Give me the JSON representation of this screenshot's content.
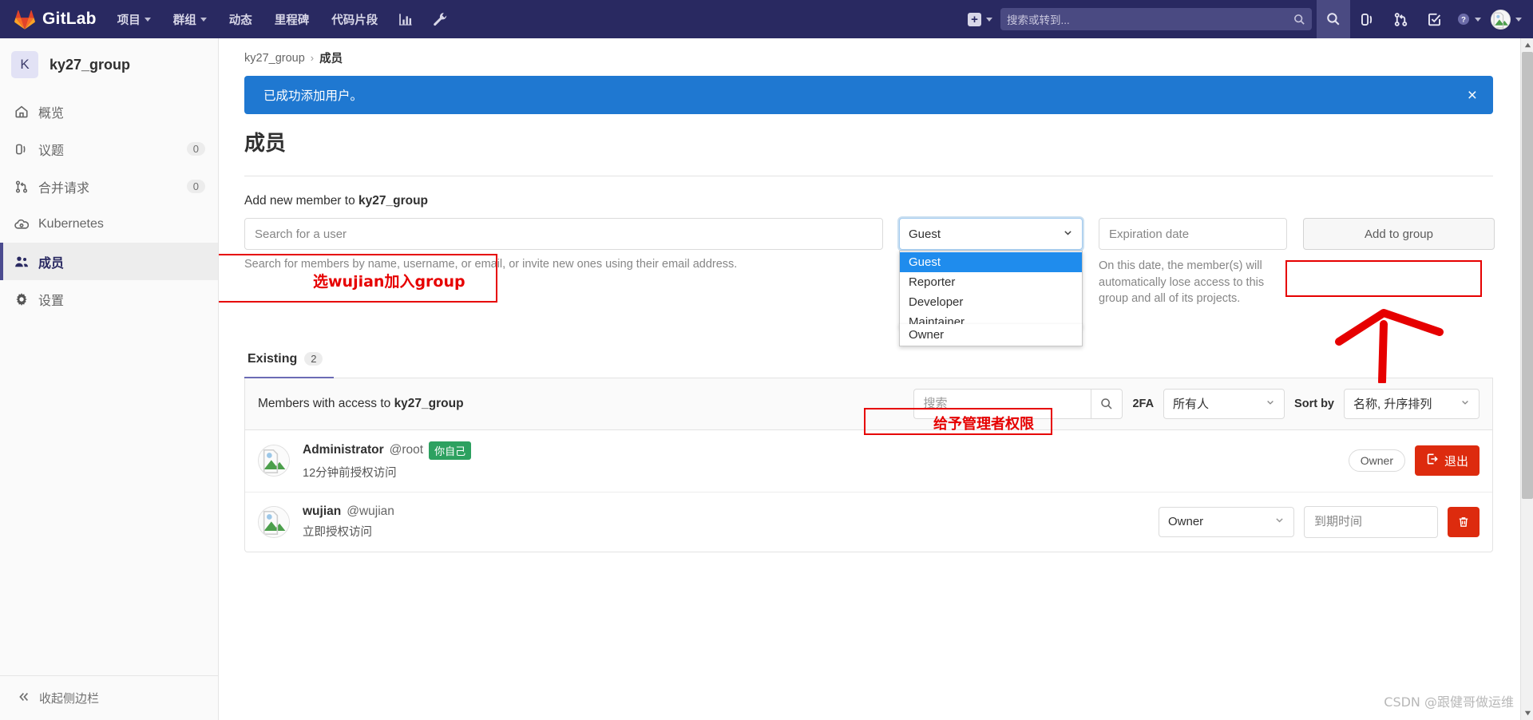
{
  "topnav": {
    "brand": "GitLab",
    "links": [
      {
        "label": "项目",
        "has_caret": true
      },
      {
        "label": "群组",
        "has_caret": true
      },
      {
        "label": "动态",
        "has_caret": false
      },
      {
        "label": "里程碑",
        "has_caret": false
      },
      {
        "label": "代码片段",
        "has_caret": false
      }
    ],
    "icon_links": [
      {
        "name": "analytics-icon"
      },
      {
        "name": "wrench-icon"
      }
    ],
    "create_label": "+",
    "search_placeholder": "搜索或转到...",
    "right_icons": [
      {
        "name": "search-icon"
      },
      {
        "name": "issues-icon"
      },
      {
        "name": "merge-requests-icon"
      },
      {
        "name": "todos-icon"
      },
      {
        "name": "help-icon"
      }
    ]
  },
  "sidebar": {
    "group_initial": "K",
    "group_name": "ky27_group",
    "items": [
      {
        "label": "概览",
        "icon": "home-icon",
        "count": null,
        "active": false
      },
      {
        "label": "议题",
        "icon": "issues-icon",
        "count": "0",
        "active": false
      },
      {
        "label": "合并请求",
        "icon": "merge-request-icon",
        "count": "0",
        "active": false
      },
      {
        "label": "Kubernetes",
        "icon": "kubernetes-icon",
        "count": null,
        "active": false
      },
      {
        "label": "成员",
        "icon": "users-icon",
        "count": null,
        "active": true
      },
      {
        "label": "设置",
        "icon": "gear-icon",
        "count": null,
        "active": false
      }
    ],
    "collapse_label": "收起侧边栏"
  },
  "breadcrumb": {
    "root": "ky27_group",
    "separator": "›",
    "current": "成员"
  },
  "alert": {
    "message": "已成功添加用户。",
    "close": "×"
  },
  "page": {
    "title": "成员"
  },
  "add_member": {
    "label_prefix": "Add new member to ",
    "group_name": "ky27_group",
    "search_placeholder": "Search for a user",
    "help_text": "Search for members by name, username, or email, or invite new ones using their email address.",
    "role_selected": "Guest",
    "role_options": [
      "Guest",
      "Reporter",
      "Developer",
      "Maintainer",
      "Owner"
    ],
    "expiration_placeholder": "Expiration date",
    "expiration_note": "On this date, the member(s) will automatically lose access to this group and all of its projects.",
    "add_button": "Add to group"
  },
  "tabs": [
    {
      "label": "Existing",
      "badge": "2",
      "active": true
    }
  ],
  "members_panel": {
    "header_prefix": "Members with access to ",
    "header_group": "ky27_group",
    "search_placeholder": "搜索",
    "twofa_label": "2FA",
    "twofa_value": "所有人",
    "sort_label": "Sort by",
    "sort_value": "名称, 升序排列",
    "rows": [
      {
        "name": "Administrator",
        "handle": "@root",
        "self_badge": "你自己",
        "access_text": "12分钟前授权访问",
        "role_pill": "Owner",
        "action_button": "退出",
        "action_icon": "sign-out-icon",
        "role_select": null,
        "expiration_placeholder": null,
        "delete_icon": null
      },
      {
        "name": "wujian",
        "handle": "@wujian",
        "self_badge": null,
        "access_text": "立即授权访问",
        "role_pill": null,
        "action_button": null,
        "action_icon": null,
        "role_select": "Owner",
        "expiration_placeholder": "到期时间",
        "delete_icon": "trash-icon"
      }
    ]
  },
  "annotations": {
    "search_note": "选wujian加入group",
    "owner_note": "给予管理者权限",
    "color": "#e60000"
  },
  "watermark": "CSDN @跟健哥做运维"
}
